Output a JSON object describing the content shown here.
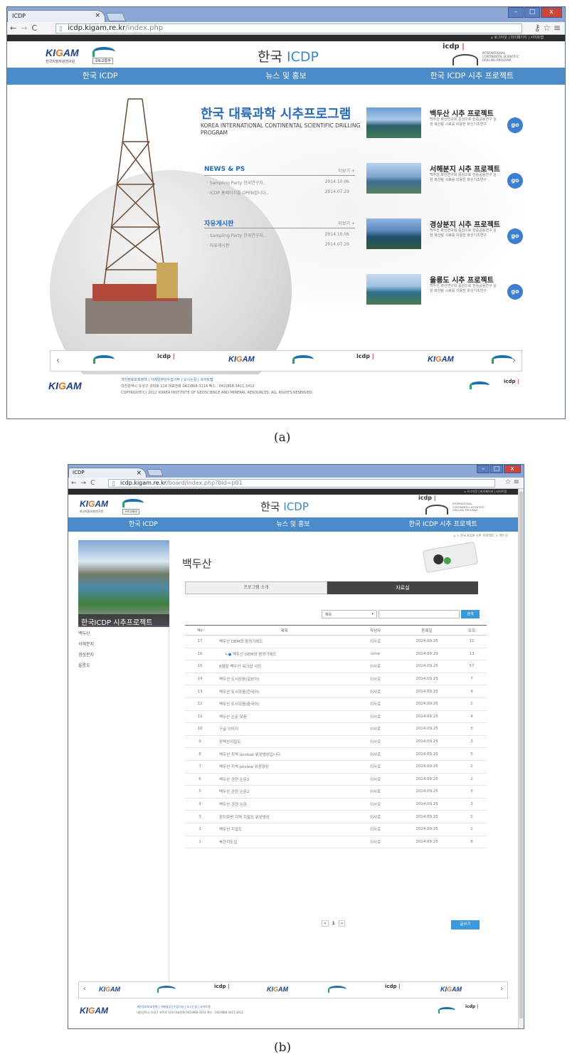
{
  "captions": {
    "a": "(a)",
    "b": "(b)"
  },
  "colors": {
    "menu": "#4b8bc9",
    "chrome": "#8ca7d4",
    "go": "#3c7fd0",
    "accent_red": "#d22222"
  },
  "a": {
    "tab_title": "ICDP",
    "url_host": "icdp.kigam.re.kr",
    "url_path": "/index.php",
    "util_links": "로그아웃 | 마이페이지 | 사이트맵",
    "logo": {
      "ki": "KI",
      "g": "G",
      "am": "AM",
      "sub": "한국지질자원연구원"
    },
    "molit": "국토교통부",
    "site_title_a": "한국",
    "site_title_b": "ICDP",
    "icdp_logo": "icdp",
    "icdp_sub": "INTERNATIONAL CONTINENTAL SCIENTIFIC DRILLING PROGRAM",
    "menu": [
      "한국 ICDP",
      "뉴스 및 홍보",
      "한국 ICDP 시추 프로젝트"
    ],
    "hero_title": "한국 대륙과학 시추프로그램",
    "hero_sub": "KOREA INTERNATIONAL CONTINENTAL SCIENTIFIC DRILLING PROGRAM",
    "news": {
      "heading": "NEWS & PS",
      "more": "더보기 +",
      "items": [
        {
          "title": "· Sampling Party 한국연구자..",
          "date": "2014.10.06"
        },
        {
          "title": "· ICDP 홈페이지를 OPEN합니다..",
          "date": "2014.07.29"
        }
      ]
    },
    "board": {
      "heading": "자유게시판",
      "more": "더보기 +",
      "items": [
        {
          "title": "· Sampling Party 한국연구자..",
          "date": "2014.10.06"
        },
        {
          "title": "· 자유게시판",
          "date": "2014.07.29"
        }
      ]
    },
    "projects": [
      {
        "title": "백두산 시추 프로젝트",
        "desc": "백두산 화산연구회 중심으로 한중공동연구 실현 화산탐 시료를 이용한 화산기초연구",
        "go": "go"
      },
      {
        "title": "서해분지 시추 프로젝트",
        "desc": "백두산 화산연구회 중심으로 한중공동연구 실현 화산탐 시료를 이용한 화산기초연구",
        "go": "go"
      },
      {
        "title": "경상분지 시추 프로젝트",
        "desc": "백두산 화산연구회 중심으로 한중공동연구 실현 화산탐 시료를 이용한 화산기초연구",
        "go": "go"
      },
      {
        "title": "울릉도 시추 프로젝트",
        "desc": "백두산 화산연구회 중심으로 한중공동연구 실현 화산탐 시료를 이용한 화산기초연구",
        "go": "go"
      }
    ],
    "slider": {
      "prev": "‹",
      "next": "›"
    },
    "footer_links": "개인정보보호정책 | 이메일무단수집거부 | 오시는길 | 사이트맵",
    "footer_addr": "대전광역시 유성구 과학로 124 대표전화 042)868-3114 팩스 : 042)868-3411,3412",
    "footer_copy": "COPYRIGHT(C) 2012 KOREA INSTITUTE OF GEOSCIENCE AND MINERAL RESOURCES. ALL RIGHTS RESERVED."
  },
  "b": {
    "tab_title": "ICDP",
    "url_host": "icdp.kigam.re.kr",
    "url_path": "/board/index.php?bid=p01",
    "breadcrumb": "한국 ICDP 시추 프로젝트 > 백두산",
    "side_title": "한국ICDP 시추프로젝트",
    "side_items": [
      "백두산",
      "서해분지",
      "경상분지",
      "울릉도"
    ],
    "page_title": "백두산",
    "tabs": [
      "프로그램 소개",
      "자료실"
    ],
    "search_select": "제목",
    "search_btn": "검색",
    "columns": [
      "No",
      "제목",
      "작성자",
      "등록일",
      "조회"
    ],
    "rows": [
      {
        "no": "17",
        "title": "백두산 DEM와 음영기복도",
        "author": "이사로",
        "date": "2014.09.25",
        "views": "11"
      },
      {
        "no": "16",
        "title": "백두산 DEM와 음영기복도",
        "author": "lsme",
        "date": "2014.09.29",
        "views": "13",
        "reply": true
      },
      {
        "no": "15",
        "title": "8월말 백두산 워크샵 사진",
        "author": "이사로",
        "date": "2014.09.25",
        "views": "57"
      },
      {
        "no": "14",
        "title": "백두산 도서모음(일본어)",
        "author": "이사로",
        "date": "2014.09.25",
        "views": "7"
      },
      {
        "no": "13",
        "title": "백두산 도서모음(한국어)",
        "author": "이사로",
        "date": "2014.09.25",
        "views": "4"
      },
      {
        "no": "12",
        "title": "백두산 도서모음(중국어)",
        "author": "이사로",
        "date": "2014.09.25",
        "views": "2"
      },
      {
        "no": "11",
        "title": "백두산 논문 모음",
        "author": "이사로",
        "date": "2014.09.25",
        "views": "4"
      },
      {
        "no": "10",
        "title": "구글 이미지",
        "author": "이사로",
        "date": "2014.09.25",
        "views": "3"
      },
      {
        "no": "9",
        "title": "장백산지질도",
        "author": "이사로",
        "date": "2014.09.25",
        "views": "3"
      },
      {
        "no": "8",
        "title": "백두산 지역 landsat 위성영상입니다.",
        "author": "이사로",
        "date": "2014.09.25",
        "views": "5"
      },
      {
        "no": "7",
        "title": "백두산 지역 jstview 위성영상",
        "author": "이사로",
        "date": "2014.09.25",
        "views": "2"
      },
      {
        "no": "6",
        "title": "백두산 관련 논문2",
        "author": "이사로",
        "date": "2014.09.25",
        "views": "2"
      },
      {
        "no": "5",
        "title": "백두산 관련 논문2",
        "author": "이사로",
        "date": "2014.09.25",
        "views": "3"
      },
      {
        "no": "4",
        "title": "백두산 관련 논문",
        "author": "이사로",
        "date": "2014.09.25",
        "views": "3"
      },
      {
        "no": "3",
        "title": "장지주변 지역 지질도 위성영상",
        "author": "이사로",
        "date": "2014.09.25",
        "views": "2"
      },
      {
        "no": "2",
        "title": "백두산 지질도",
        "author": "이사로",
        "date": "2014.09.25",
        "views": "1"
      },
      {
        "no": "1",
        "title": "북한지도집",
        "author": "이사로",
        "date": "2014.09.25",
        "views": "8"
      }
    ],
    "pager": {
      "first": "«",
      "page": "1",
      "last": "»"
    },
    "write_btn": "글쓰기"
  }
}
